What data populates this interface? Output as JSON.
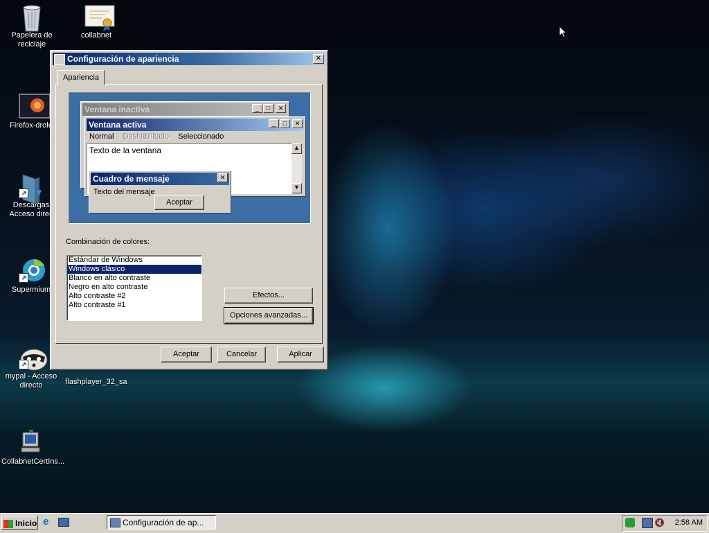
{
  "desktop": {
    "icons": [
      {
        "label": "Papelera de reciclaje"
      },
      {
        "label": "collabnet"
      },
      {
        "label": "Firefox-drole"
      },
      {
        "label": "Descargas Acceso direc"
      },
      {
        "label": "Supermium"
      },
      {
        "label": "mypal - Acceso directo"
      },
      {
        "label": "flashplayer_32_sa"
      },
      {
        "label": "CollabnetCertIns..."
      }
    ]
  },
  "dialog": {
    "title": "Configuración de apariencia",
    "tab": "Apariencia",
    "preview": {
      "inactive_title": "Ventana inactiva",
      "active_title": "Ventana activa",
      "menu": [
        "Normal",
        "Deshabilitado",
        "Seleccionado"
      ],
      "window_text": "Texto de la ventana",
      "msgbox_title": "Cuadro de mensaje",
      "msgbox_text": "Texto del mensaje",
      "msgbox_ok": "Aceptar"
    },
    "color_scheme_label": "Combinación de colores:",
    "color_schemes": [
      "Estándar de Windows",
      "Windows clásico",
      "Blanco en alto contraste",
      "Negro en alto contraste",
      "Alto contraste #2",
      "Alto contraste #1"
    ],
    "selected_scheme": "Windows clásico",
    "effects_button": "Efectos...",
    "advanced_button": "Opciones avanzadas...",
    "ok_button": "Aceptar",
    "cancel_button": "Cancelar",
    "apply_button": "Aplicar"
  },
  "taskbar": {
    "start_label": "Inicio",
    "task_item": "Configuración de ap...",
    "clock": "2:58 AM"
  }
}
